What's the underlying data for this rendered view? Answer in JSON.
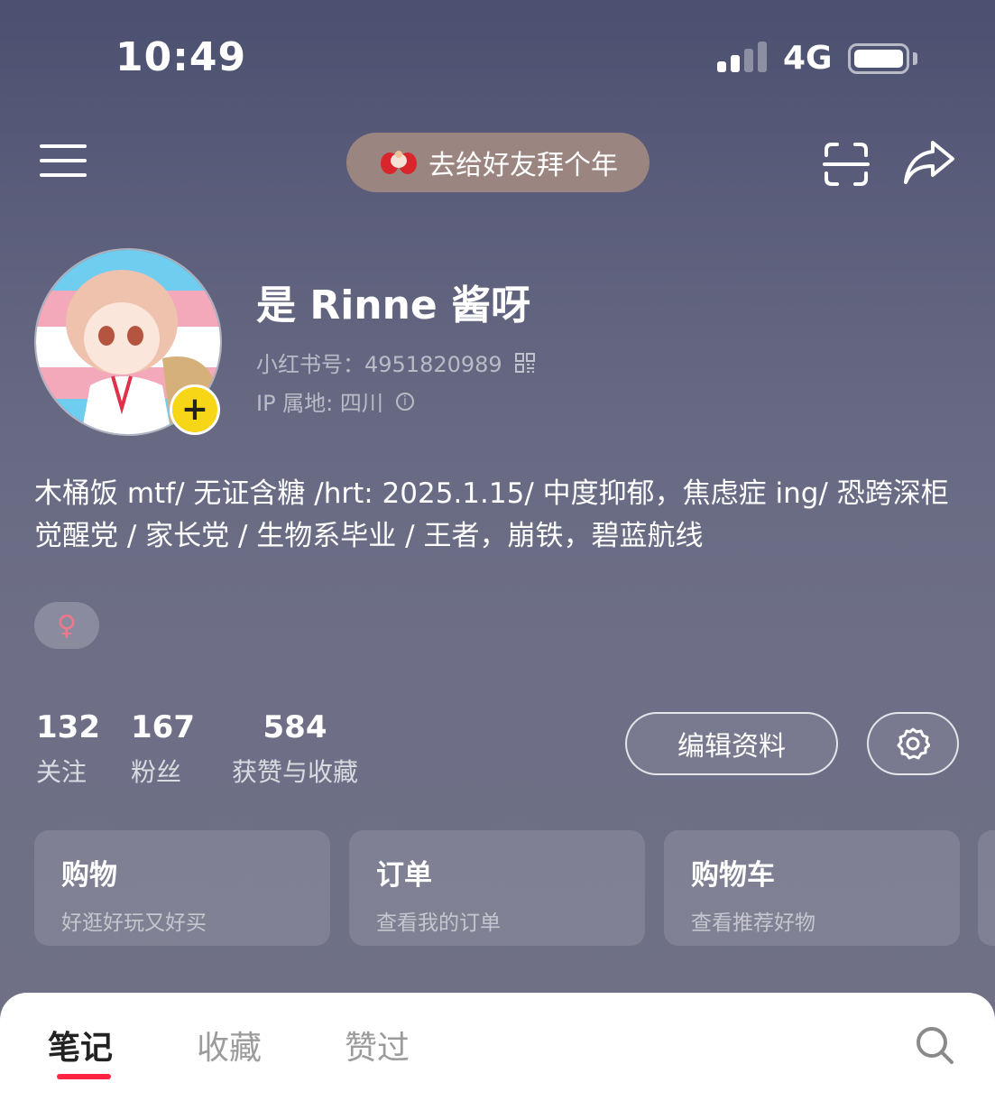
{
  "status_bar": {
    "time": "10:49",
    "network": "4G",
    "signal_bars_filled": 2,
    "signal_bars_total": 4
  },
  "top_bar": {
    "menu_icon": "menu-icon",
    "promo_label": "去给好友拜个年",
    "scan_icon": "scan-icon",
    "share_icon": "share-icon"
  },
  "profile": {
    "nickname": "是 Rinne 酱呀",
    "redbook_id_label": "小红书号：4951820989",
    "ip_label": "IP 属地: 四川",
    "bio_lines": [
      "木桶饭 mtf/ 无证含糖 /hrt: 2025.1.15/ 中度抑郁，焦虑症 ing/ 恐跨深柜",
      "觉醒党 / 家长党 / 生物系毕业 / 王者，崩铁，碧蓝航线"
    ],
    "gender_symbol": "♀",
    "add_badge": "+"
  },
  "stats": [
    {
      "count": "132",
      "label": "关注"
    },
    {
      "count": "167",
      "label": "粉丝"
    },
    {
      "count": "584",
      "label": "获赞与收藏"
    }
  ],
  "actions": {
    "edit_label": "编辑资料",
    "settings_icon": "gear-icon"
  },
  "cards": [
    {
      "title": "购物",
      "subtitle": "好逛好玩又好买"
    },
    {
      "title": "订单",
      "subtitle": "查看我的订单"
    },
    {
      "title": "购物车",
      "subtitle": "查看推荐好物"
    }
  ],
  "tabs": [
    {
      "label": "笔记",
      "active": true
    },
    {
      "label": "收藏",
      "active": false
    },
    {
      "label": "赞过",
      "active": false
    }
  ],
  "colors": {
    "accent": "#ff2442",
    "badge": "#f7d618",
    "promo_bg": "#9a8580"
  }
}
